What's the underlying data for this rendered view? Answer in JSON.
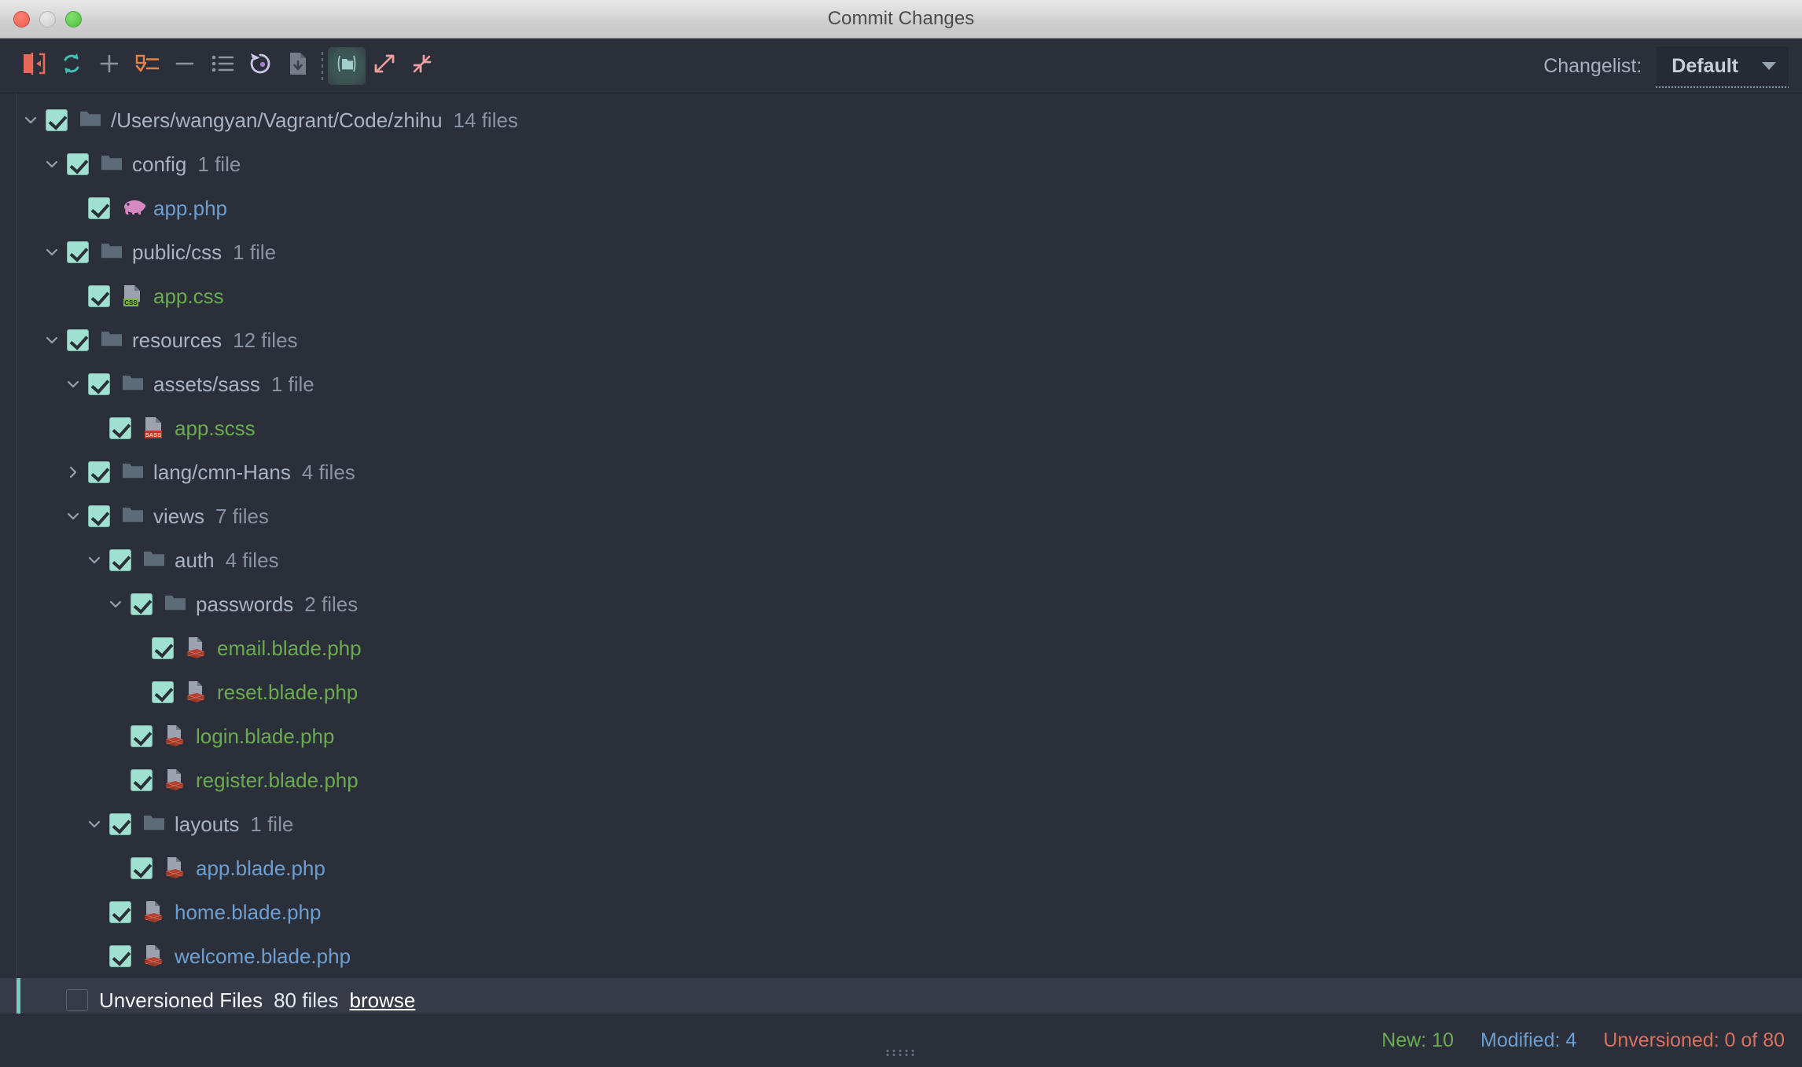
{
  "window": {
    "title": "Commit Changes",
    "traffic_lights": [
      "close",
      "minimize",
      "zoom"
    ]
  },
  "toolbar": {
    "buttons": [
      {
        "name": "show-diff-icon",
        "label": "Show Diff",
        "active": false
      },
      {
        "name": "refresh-icon",
        "label": "Refresh",
        "active": false
      },
      {
        "name": "add-icon",
        "label": "Add",
        "active": false
      },
      {
        "name": "checklist-icon",
        "label": "Move to Another Changelist",
        "active": false
      },
      {
        "name": "remove-icon",
        "label": "Delete",
        "active": false
      },
      {
        "name": "list-icon",
        "label": "Group By",
        "active": false
      },
      {
        "name": "revert-icon",
        "label": "Revert",
        "active": false
      },
      {
        "name": "file-history-icon",
        "label": "Show History",
        "active": false
      },
      {
        "name": "separator",
        "label": "",
        "active": false
      },
      {
        "name": "folder-icon",
        "label": "Group by Directory",
        "active": true
      },
      {
        "name": "expand-all-icon",
        "label": "Expand All",
        "active": false
      },
      {
        "name": "collapse-all-icon",
        "label": "Collapse All",
        "active": false
      }
    ],
    "changelist_label": "Changelist:",
    "changelist_value": "Default",
    "changelist_options": [
      "Default"
    ]
  },
  "tree": {
    "rows": [
      {
        "indent": 0,
        "twisty": "expanded",
        "checked": true,
        "icon": "folder",
        "name": "/Users/wangyan/Vagrant/Code/zhihu",
        "count": "14 files",
        "color": "folder"
      },
      {
        "indent": 1,
        "twisty": "expanded",
        "checked": true,
        "icon": "folder",
        "name": "config",
        "count": "1 file",
        "color": "folder"
      },
      {
        "indent": 2,
        "twisty": "none",
        "checked": true,
        "icon": "php",
        "name": "app.php",
        "count": "",
        "color": "blue"
      },
      {
        "indent": 1,
        "twisty": "expanded",
        "checked": true,
        "icon": "folder",
        "name": "public/css",
        "count": "1 file",
        "color": "folder"
      },
      {
        "indent": 2,
        "twisty": "none",
        "checked": true,
        "icon": "css",
        "name": "app.css",
        "count": "",
        "color": "green"
      },
      {
        "indent": 1,
        "twisty": "expanded",
        "checked": true,
        "icon": "folder",
        "name": "resources",
        "count": "12 files",
        "color": "folder"
      },
      {
        "indent": 2,
        "twisty": "expanded",
        "checked": true,
        "icon": "folder",
        "name": "assets/sass",
        "count": "1 file",
        "color": "folder"
      },
      {
        "indent": 3,
        "twisty": "none",
        "checked": true,
        "icon": "sass",
        "name": "app.scss",
        "count": "",
        "color": "green"
      },
      {
        "indent": 2,
        "twisty": "collapsed",
        "checked": true,
        "icon": "folder",
        "name": "lang/cmn-Hans",
        "count": "4 files",
        "color": "folder"
      },
      {
        "indent": 2,
        "twisty": "expanded",
        "checked": true,
        "icon": "folder",
        "name": "views",
        "count": "7 files",
        "color": "folder"
      },
      {
        "indent": 3,
        "twisty": "expanded",
        "checked": true,
        "icon": "folder",
        "name": "auth",
        "count": "4 files",
        "color": "folder"
      },
      {
        "indent": 4,
        "twisty": "expanded",
        "checked": true,
        "icon": "folder",
        "name": "passwords",
        "count": "2 files",
        "color": "folder"
      },
      {
        "indent": 5,
        "twisty": "none",
        "checked": true,
        "icon": "blade",
        "name": "email.blade.php",
        "count": "",
        "color": "green"
      },
      {
        "indent": 5,
        "twisty": "none",
        "checked": true,
        "icon": "blade",
        "name": "reset.blade.php",
        "count": "",
        "color": "green"
      },
      {
        "indent": 4,
        "twisty": "none",
        "checked": true,
        "icon": "blade",
        "name": "login.blade.php",
        "count": "",
        "color": "green"
      },
      {
        "indent": 4,
        "twisty": "none",
        "checked": true,
        "icon": "blade",
        "name": "register.blade.php",
        "count": "",
        "color": "green"
      },
      {
        "indent": 3,
        "twisty": "expanded",
        "checked": true,
        "icon": "folder",
        "name": "layouts",
        "count": "1 file",
        "color": "folder"
      },
      {
        "indent": 4,
        "twisty": "none",
        "checked": true,
        "icon": "blade",
        "name": "app.blade.php",
        "count": "",
        "color": "blue"
      },
      {
        "indent": 3,
        "twisty": "none",
        "checked": true,
        "icon": "blade",
        "name": "home.blade.php",
        "count": "",
        "color": "blue"
      },
      {
        "indent": 3,
        "twisty": "none",
        "checked": true,
        "icon": "blade",
        "name": "welcome.blade.php",
        "count": "",
        "color": "blue"
      }
    ],
    "unversioned": {
      "checked": false,
      "name": "Unversioned Files",
      "count": "80 files",
      "browse_label": "browse",
      "selected": true
    }
  },
  "statusbar": {
    "new_label": "New: 10",
    "modified_label": "Modified: 4",
    "unversioned_label": "Unversioned: 0 of 80"
  },
  "colors": {
    "new": "#6aab51",
    "modified": "#6c9fd0",
    "unversioned": "#d9705f",
    "checkbox": "#9fe0d0",
    "accent": "#72cfc0",
    "background": "#2b2f3a"
  }
}
